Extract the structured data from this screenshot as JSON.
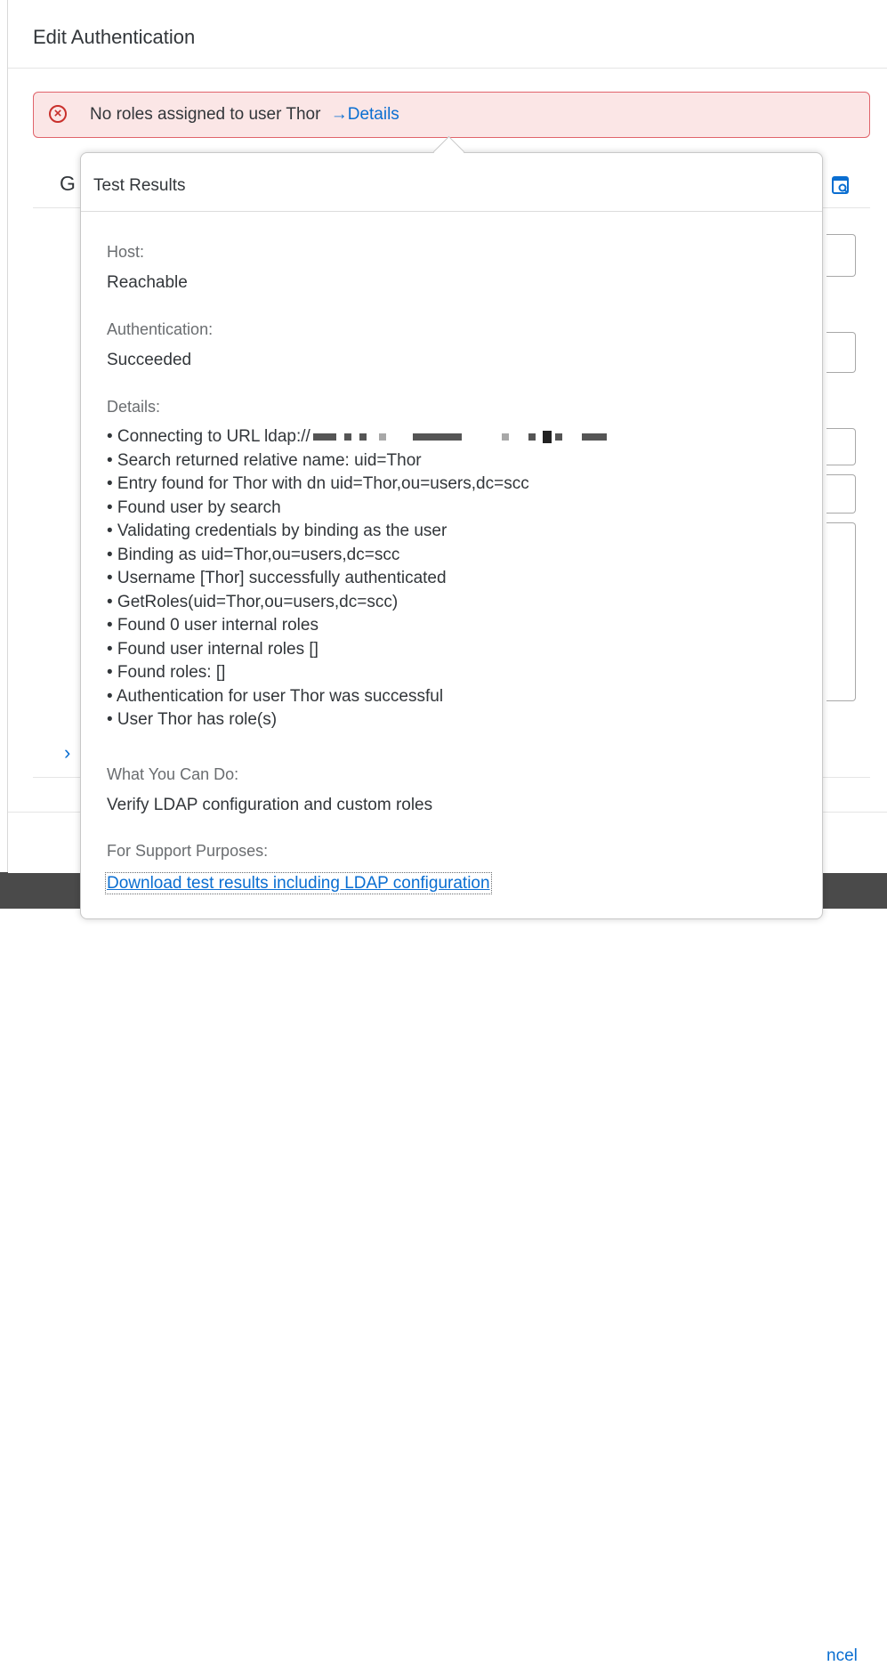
{
  "dialog": {
    "title": "Edit Authentication",
    "error": {
      "icon": "error-circle-icon",
      "message": "No roles assigned to user Thor",
      "link": "→Details"
    },
    "section_title_partial": "G",
    "footer_button_partial": "ncel"
  },
  "popover": {
    "title": "Test Results",
    "host": {
      "label": "Host:",
      "value": "Reachable"
    },
    "authentication": {
      "label": "Authentication:",
      "value": "Succeeded"
    },
    "details": {
      "label": "Details:",
      "items": [
        "• Connecting to URL ldap://",
        "• Search returned relative name: uid=Thor",
        "• Entry found for Thor with dn uid=Thor,ou=users,dc=scc",
        "• Found user by search",
        "• Validating credentials by binding as the user",
        "• Binding as uid=Thor,ou=users,dc=scc",
        "• Username [Thor] successfully authenticated",
        "• GetRoles(uid=Thor,ou=users,dc=scc)",
        "• Found 0 user internal roles",
        "• Found user internal roles []",
        "• Found roles: []",
        "• Authentication for user Thor was successful",
        "• User Thor has role(s)"
      ]
    },
    "what_you_can_do": {
      "label": "What You Can Do:",
      "value": "Verify LDAP configuration and custom roles"
    },
    "support": {
      "label": "For Support Purposes:",
      "link": "Download test results including LDAP configuration"
    }
  }
}
